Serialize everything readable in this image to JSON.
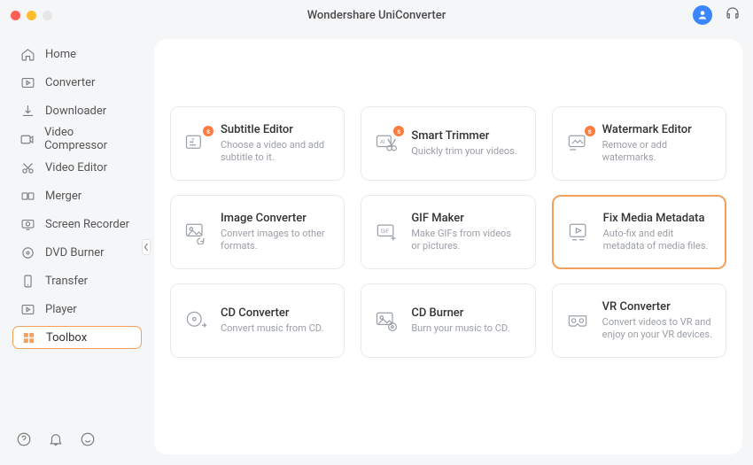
{
  "app": {
    "title": "Wondershare UniConverter"
  },
  "sidebar": {
    "items": [
      {
        "label": "Home",
        "icon": "home-icon"
      },
      {
        "label": "Converter",
        "icon": "converter-icon"
      },
      {
        "label": "Downloader",
        "icon": "download-icon"
      },
      {
        "label": "Video Compressor",
        "icon": "compress-icon"
      },
      {
        "label": "Video Editor",
        "icon": "editor-icon"
      },
      {
        "label": "Merger",
        "icon": "merger-icon"
      },
      {
        "label": "Screen Recorder",
        "icon": "recorder-icon"
      },
      {
        "label": "DVD Burner",
        "icon": "dvd-icon"
      },
      {
        "label": "Transfer",
        "icon": "transfer-icon"
      },
      {
        "label": "Player",
        "icon": "player-icon"
      },
      {
        "label": "Toolbox",
        "icon": "toolbox-icon",
        "active": true
      }
    ]
  },
  "tools": [
    {
      "title": "Subtitle Editor",
      "desc": "Choose a video and add subtitle to it.",
      "icon": "subtitle-icon",
      "badge": "s"
    },
    {
      "title": "Smart Trimmer",
      "desc": "Quickly trim your videos.",
      "icon": "trim-icon",
      "badge": "s"
    },
    {
      "title": "Watermark Editor",
      "desc": "Remove or add watermarks.",
      "icon": "watermark-icon",
      "badge": "s"
    },
    {
      "title": "Image Converter",
      "desc": "Convert images to other formats.",
      "icon": "image-icon"
    },
    {
      "title": "GIF Maker",
      "desc": "Make GIFs from videos or pictures.",
      "icon": "gif-icon"
    },
    {
      "title": "Fix Media Metadata",
      "desc": "Auto-fix and edit metadata of media files.",
      "icon": "meta-icon",
      "highlight": true
    },
    {
      "title": "CD Converter",
      "desc": "Convert music from CD.",
      "icon": "cdconv-icon"
    },
    {
      "title": "CD Burner",
      "desc": "Burn your music to CD.",
      "icon": "cdburn-icon"
    },
    {
      "title": "VR Converter",
      "desc": "Convert videos to VR and enjoy on your VR devices.",
      "icon": "vr-icon"
    }
  ],
  "colors": {
    "accent": "#f5a05a",
    "badge": "#ff7b3d",
    "avatar": "#3a86ff"
  }
}
